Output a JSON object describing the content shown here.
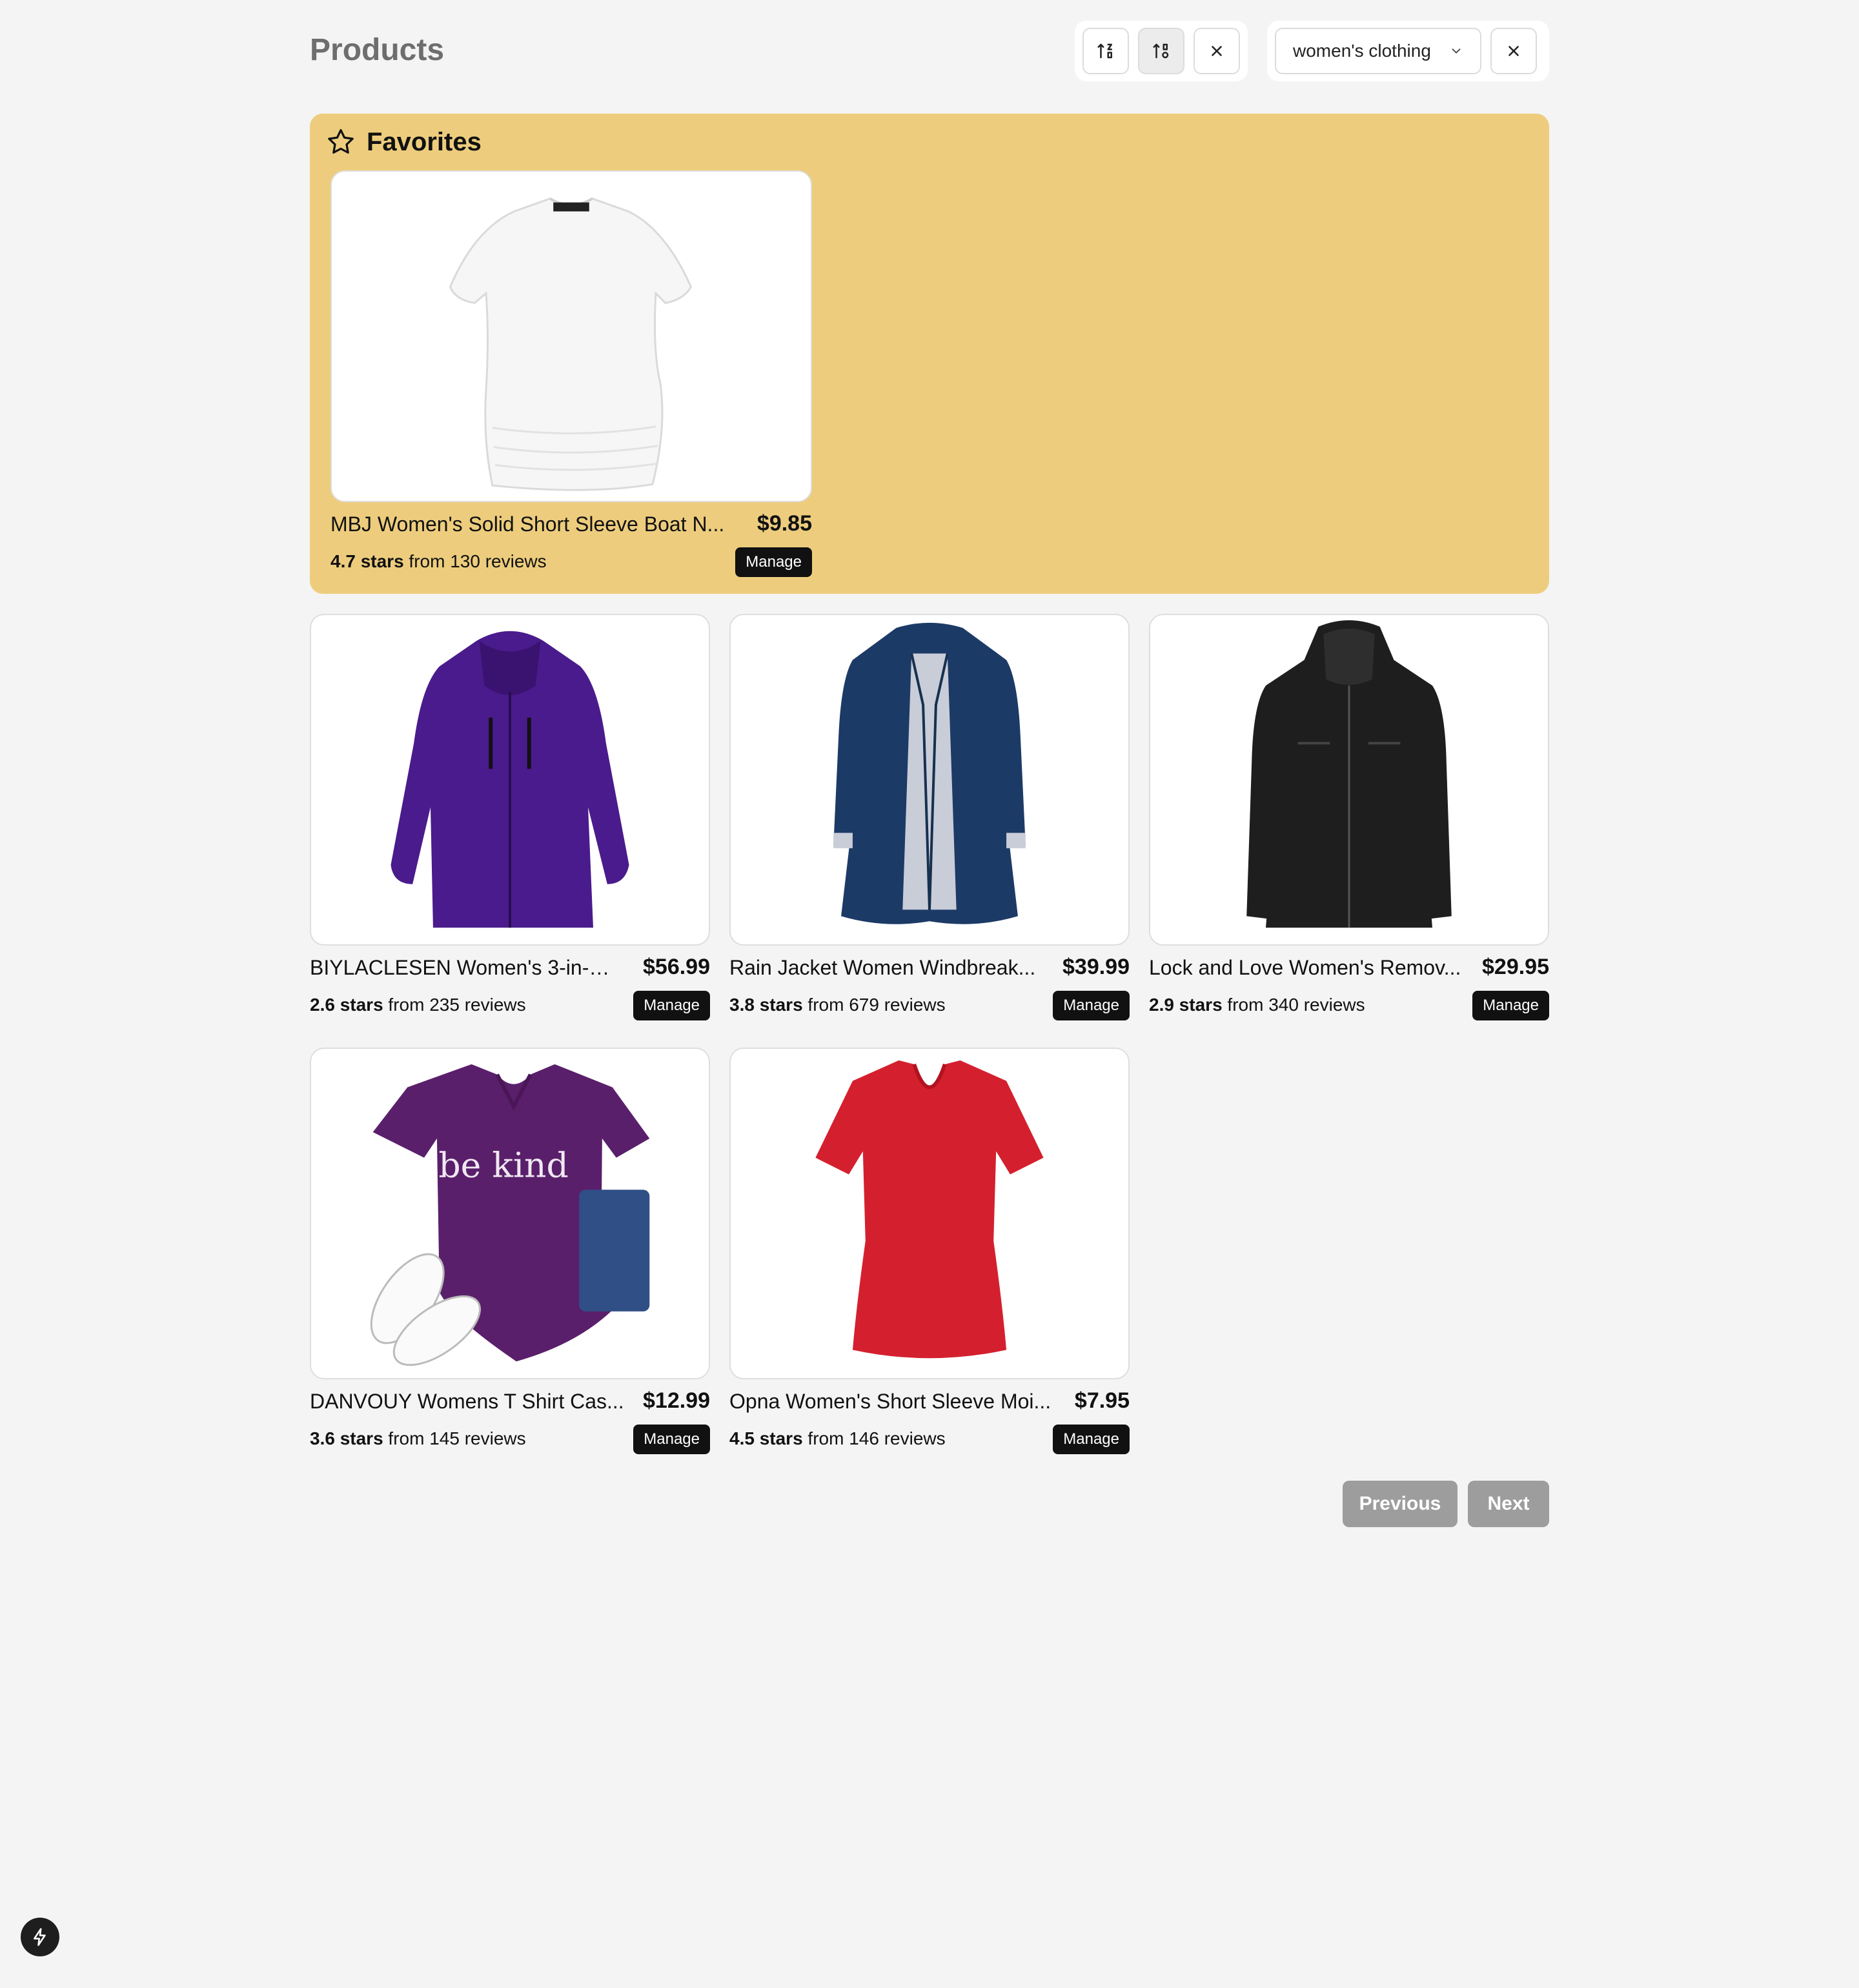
{
  "header": {
    "title": "Products",
    "filter_value": "women's clothing"
  },
  "icons": {
    "sort_asc": "sort-ascending-icon",
    "sort_desc": "sort-descending-icon",
    "clear_sort": "close-icon",
    "dropdown": "chevron-down-icon",
    "clear_filter": "close-icon",
    "favorites": "star-outline-icon",
    "dev": "lightning-bolt-icon"
  },
  "favorites": {
    "title": "Favorites",
    "items": [
      {
        "name": "MBJ Women's Solid Short Sleeve Boat N...",
        "price": "$9.85",
        "stars": "4.7 stars",
        "reviews": "from 130 reviews",
        "manage": "Manage"
      }
    ]
  },
  "products": [
    {
      "name": "BIYLACLESEN Women's 3-in-1 ...",
      "price": "$56.99",
      "stars": "2.6 stars",
      "reviews": "from 235 reviews",
      "manage": "Manage"
    },
    {
      "name": "Rain Jacket Women Windbreak...",
      "price": "$39.99",
      "stars": "3.8 stars",
      "reviews": "from 679 reviews",
      "manage": "Manage"
    },
    {
      "name": "Lock and Love Women's Remov...",
      "price": "$29.95",
      "stars": "2.9 stars",
      "reviews": "from 340 reviews",
      "manage": "Manage"
    },
    {
      "name": "DANVOUY Womens T Shirt Cas...",
      "price": "$12.99",
      "stars": "3.6 stars",
      "reviews": "from 145 reviews",
      "manage": "Manage"
    },
    {
      "name": "Opna Women's Short Sleeve Moi...",
      "price": "$7.95",
      "stars": "4.5 stars",
      "reviews": "from 146 reviews",
      "manage": "Manage"
    }
  ],
  "product_images": {
    "tee_print": "be kind"
  },
  "pagination": {
    "previous": "Previous",
    "next": "Next"
  },
  "colors": {
    "favorites_bg": "#edcd7d",
    "manage_bg": "#111111",
    "pager_bg": "#9d9d9d"
  }
}
